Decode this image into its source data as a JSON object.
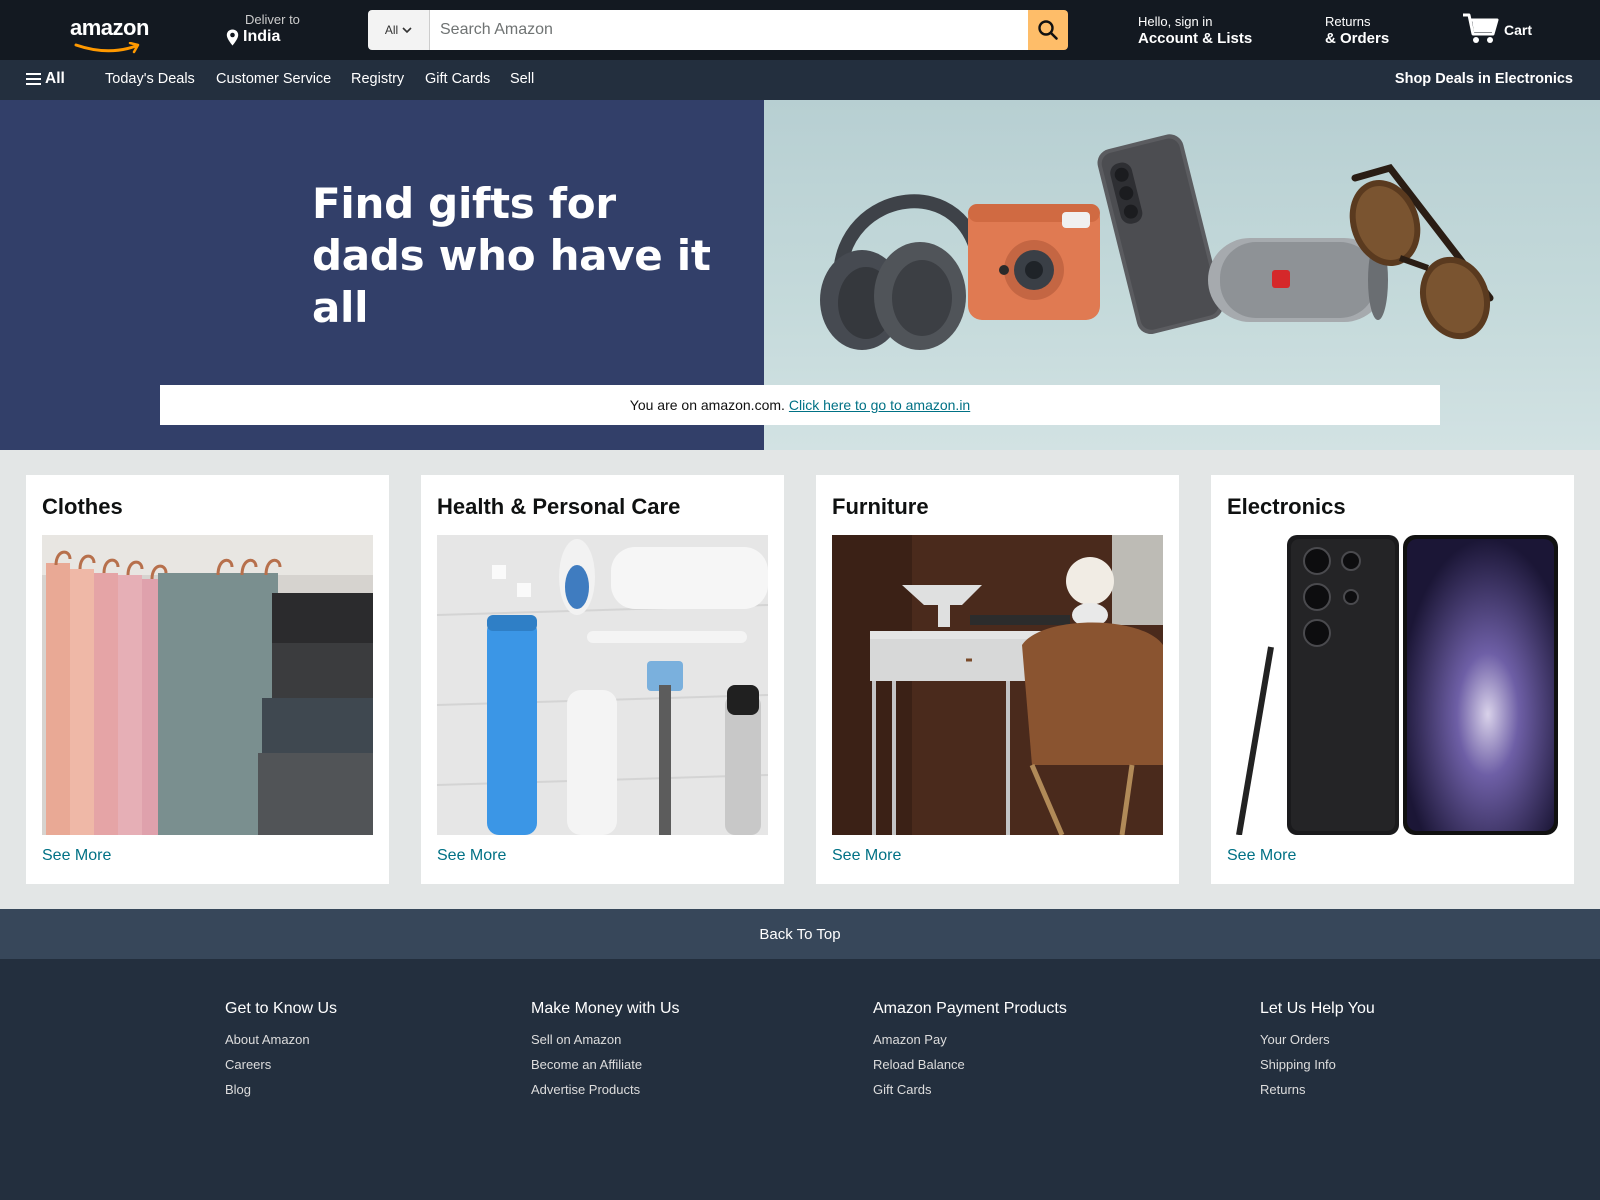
{
  "header": {
    "logo": "amazon",
    "deliver_label": "Deliver to",
    "deliver_location": "India",
    "search_category": "All",
    "search_placeholder": "Search Amazon",
    "account_small": "Hello, sign in",
    "account_big": "Account & Lists",
    "returns_small": "Returns",
    "returns_big": "& Orders",
    "cart_label": "Cart"
  },
  "subnav": {
    "all_label": "All",
    "items": [
      "Today's Deals",
      "Customer Service",
      "Registry",
      "Gift Cards",
      "Sell"
    ],
    "right_label": "Shop Deals in Electronics"
  },
  "hero": {
    "title_line1": "Find gifts for",
    "title_line2": "dads who have it all",
    "notice_text": "You are on amazon.com.",
    "notice_link": "Click here to go to amazon.in"
  },
  "cards": [
    {
      "title": "Clothes",
      "link": "See More"
    },
    {
      "title": "Health & Personal Care",
      "link": "See More"
    },
    {
      "title": "Furniture",
      "link": "See More"
    },
    {
      "title": "Electronics",
      "link": "See More"
    }
  ],
  "footer": {
    "back_to_top": "Back To Top",
    "columns": [
      {
        "heading": "Get to Know Us",
        "links": [
          "About Amazon",
          "Careers",
          "Blog"
        ]
      },
      {
        "heading": "Make Money with Us",
        "links": [
          "Sell on Amazon",
          "Become an Affiliate",
          "Advertise Products"
        ]
      },
      {
        "heading": "Amazon Payment Products",
        "links": [
          "Amazon Pay",
          "Reload Balance",
          "Gift Cards"
        ]
      },
      {
        "heading": "Let Us Help You",
        "links": [
          "Your Orders",
          "Shipping Info",
          "Returns"
        ]
      }
    ]
  },
  "colors": {
    "nav_top": "#131921",
    "nav_sub": "#232f3e",
    "search_button": "#febd69",
    "hero_left": "#323f69",
    "link": "#007185",
    "back_to_top": "#37475a"
  },
  "icons": [
    "location-pin-icon",
    "chevron-down-icon",
    "search-icon",
    "cart-icon",
    "hamburger-icon"
  ]
}
